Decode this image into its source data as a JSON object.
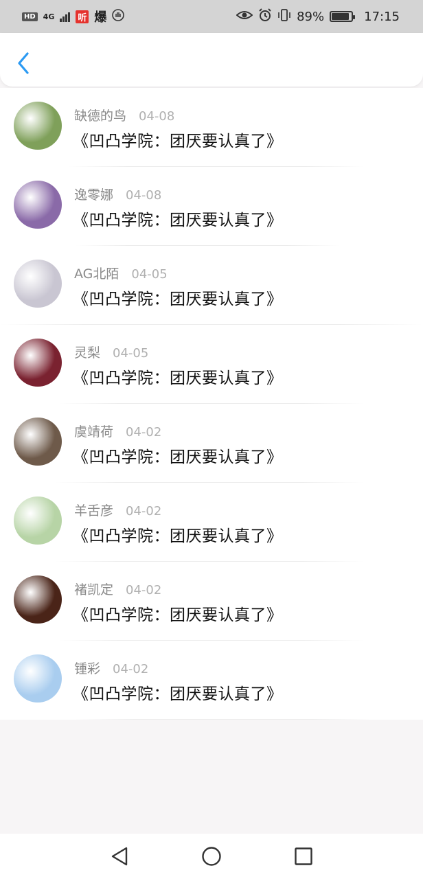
{
  "status_bar": {
    "hd_badge": "HD",
    "network": "4G",
    "app_badge": "听",
    "burst_label": "爆",
    "battery_percent": "89%",
    "battery_level": 0.89,
    "time": "17:15"
  },
  "header": {
    "back_icon": "chevron-left-icon"
  },
  "list": [
    {
      "name": "缺德的鸟",
      "date": "04-08",
      "title": "《凹凸学院：团厌要认真了》",
      "avatar_color": "#7fa05a"
    },
    {
      "name": "逸零娜",
      "date": "04-08",
      "title": "《凹凸学院：团厌要认真了》",
      "avatar_color": "#8a6aa8"
    },
    {
      "name": "AG北陌",
      "date": "04-05",
      "title": "《凹凸学院：团厌要认真了》",
      "avatar_color": "#c9c6d2"
    },
    {
      "name": "灵梨",
      "date": "04-05",
      "title": "《凹凸学院：团厌要认真了》",
      "avatar_color": "#7a2230"
    },
    {
      "name": "虞靖荷",
      "date": "04-02",
      "title": "《凹凸学院：团厌要认真了》",
      "avatar_color": "#6e5a4a"
    },
    {
      "name": "羊舌彦",
      "date": "04-02",
      "title": "《凹凸学院：团厌要认真了》",
      "avatar_color": "#b7d4a6"
    },
    {
      "name": "褚凯定",
      "date": "04-02",
      "title": "《凹凸学院：团厌要认真了》",
      "avatar_color": "#4a2418"
    },
    {
      "name": "锺彩",
      "date": "04-02",
      "title": "《凹凸学院：团厌要认真了》",
      "avatar_color": "#a9cdef"
    }
  ],
  "nav_bar": {
    "back_icon": "triangle-back-icon",
    "home_icon": "circle-home-icon",
    "recents_icon": "square-recents-icon"
  }
}
